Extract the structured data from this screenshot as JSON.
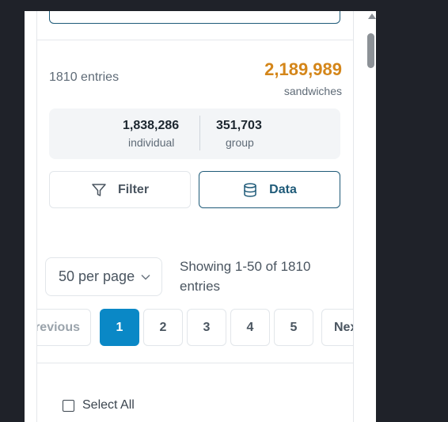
{
  "summary": {
    "entries_text": "1810 entries",
    "sandwich_count": "2,189,989",
    "sandwich_label": "sandwiches",
    "individual_value": "1,838,286",
    "individual_label": "individual",
    "group_value": "351,703",
    "group_label": "group"
  },
  "actions": {
    "filter_label": "Filter",
    "data_label": "Data"
  },
  "pagination": {
    "per_page": "50 per page",
    "showing_line1": "Showing 1-50 of 1810",
    "showing_line2": "entries",
    "prev_label": "Previous",
    "pages": [
      "1",
      "2",
      "3",
      "4",
      "5"
    ],
    "active_page": "1",
    "next_label": "Next"
  },
  "list": {
    "select_all_label": "Select All"
  },
  "icons": {
    "filter": "filter-icon",
    "data": "database-icon",
    "per_page_chevron": "chevron-down-icon"
  },
  "colors": {
    "accent_orange": "#d4861a",
    "primary_teal": "#1e5a78",
    "active_blue": "#0a88c6",
    "page_background": "#1f2229"
  }
}
